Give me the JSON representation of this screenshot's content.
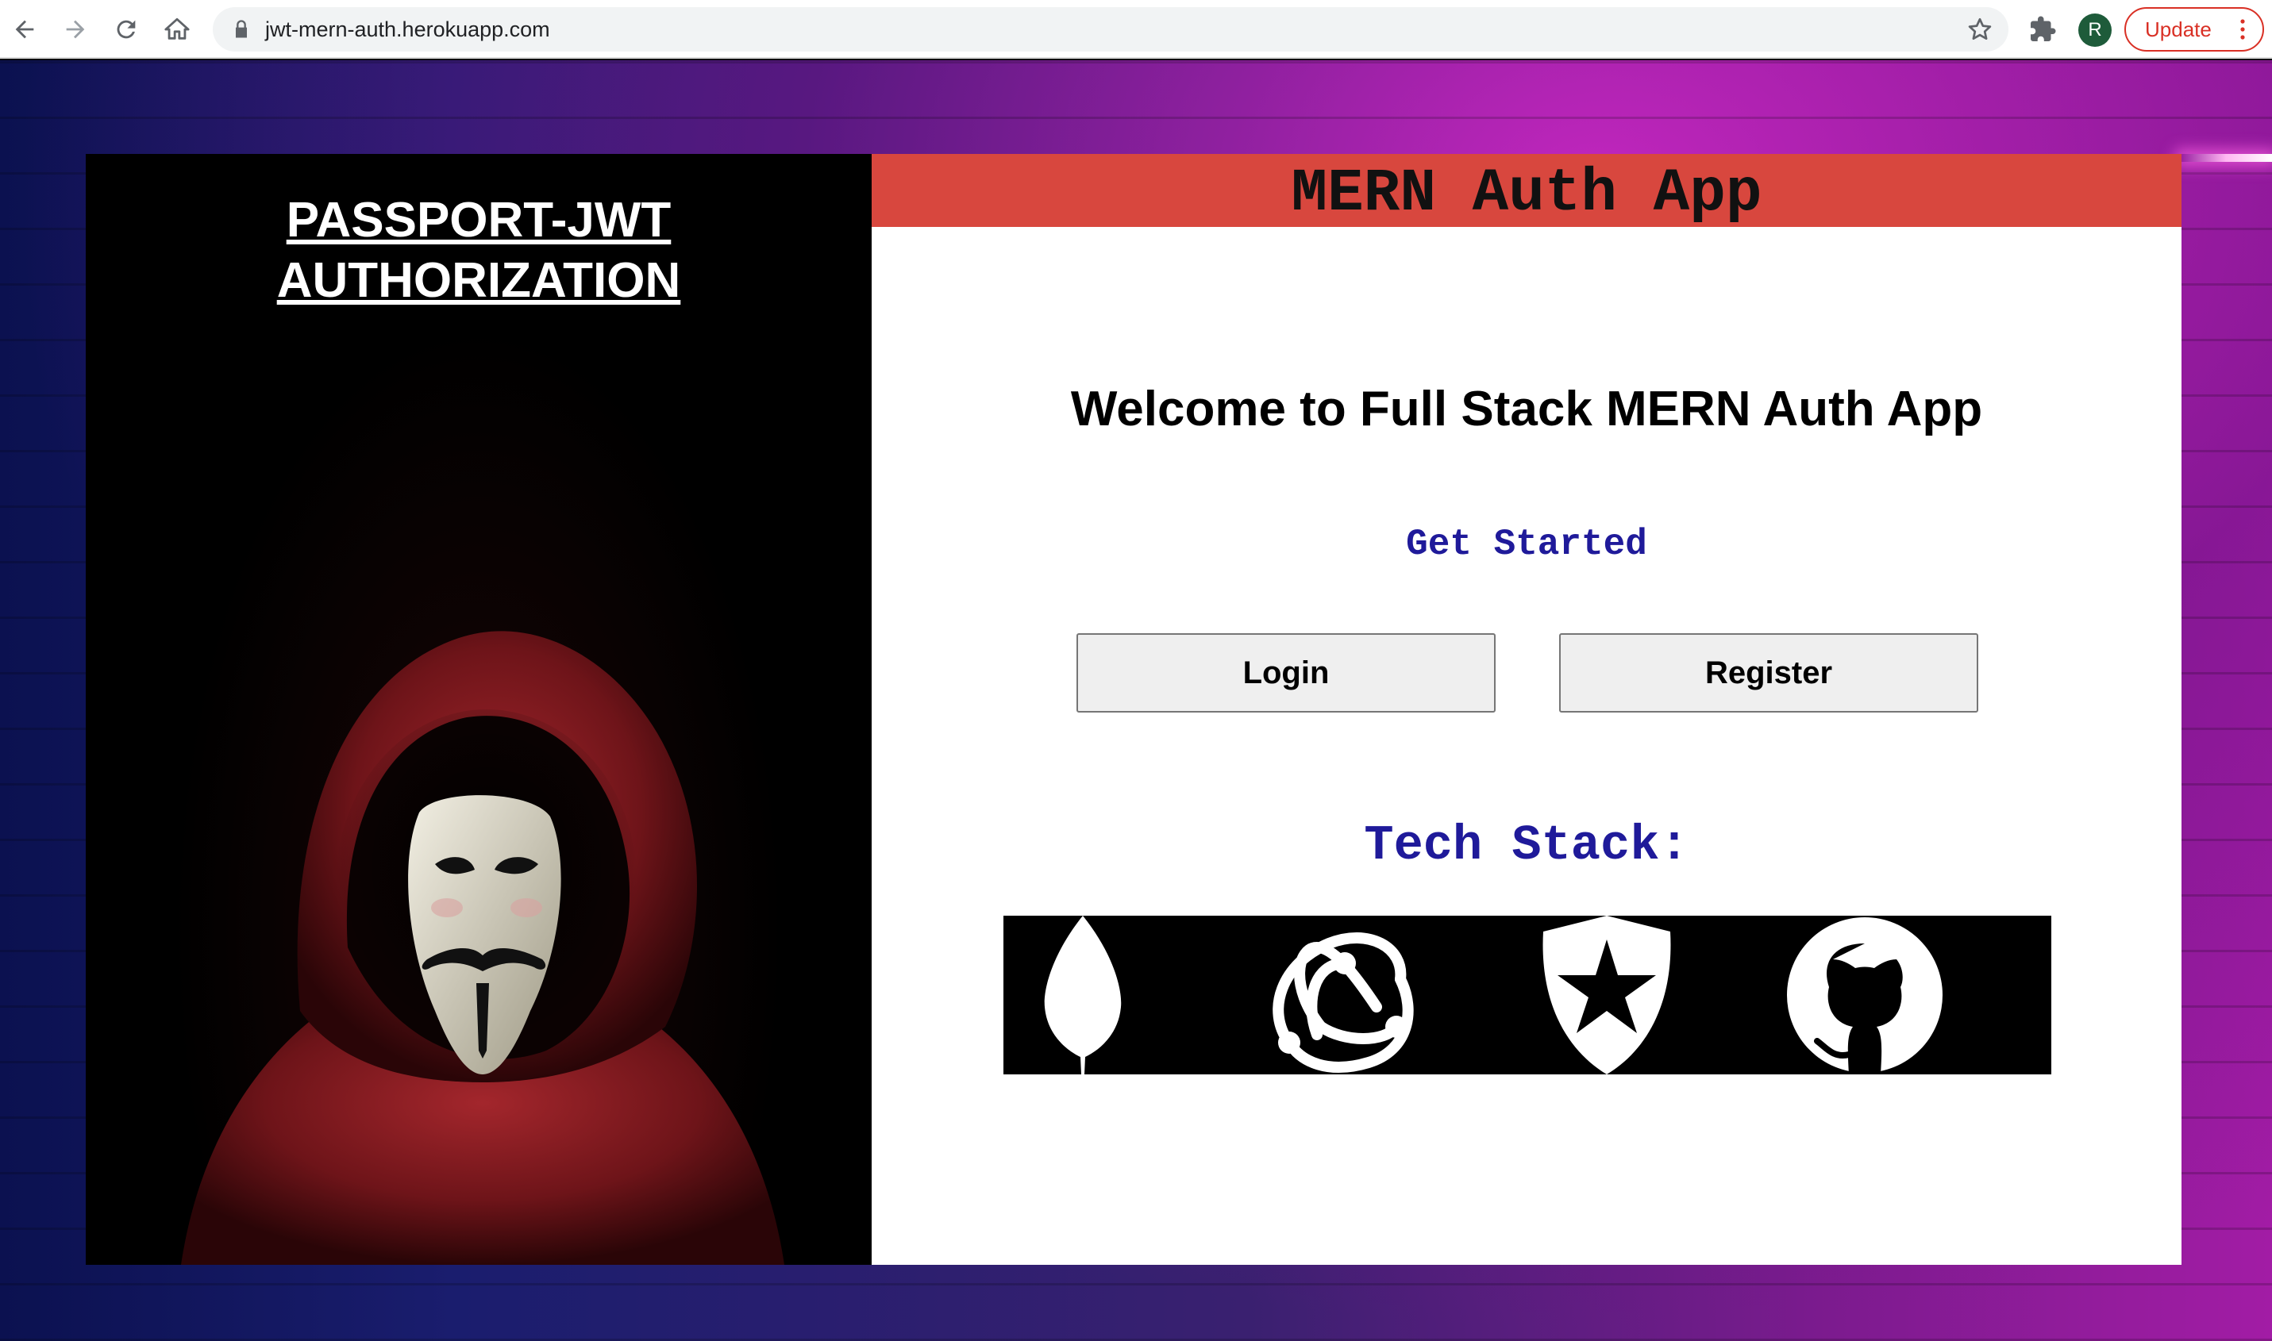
{
  "browser": {
    "url": "jwt-mern-auth.herokuapp.com",
    "profile_initial": "R",
    "update_label": "Update",
    "icons": [
      "back-arrow-icon",
      "forward-arrow-icon",
      "reload-icon",
      "home-icon",
      "lock-icon",
      "star-icon",
      "extensions-icon",
      "kebab-menu-icon"
    ]
  },
  "hero": {
    "title_line1": "PASSPORT-JWT",
    "title_line2": "AUTHORIZATION"
  },
  "card": {
    "header_title": "MERN Auth App",
    "welcome": "Welcome to Full Stack MERN Auth App",
    "get_started": "Get Started",
    "login_label": "Login",
    "register_label": "Register",
    "tech_stack_title": "Tech Stack:",
    "tech_logos": [
      "mongodb-icon",
      "redux-icon",
      "auth0-icon",
      "github-icon"
    ]
  },
  "colors": {
    "header_red": "#d8473e",
    "accent_blue": "#1f1a9a",
    "update_red": "#d93025"
  }
}
